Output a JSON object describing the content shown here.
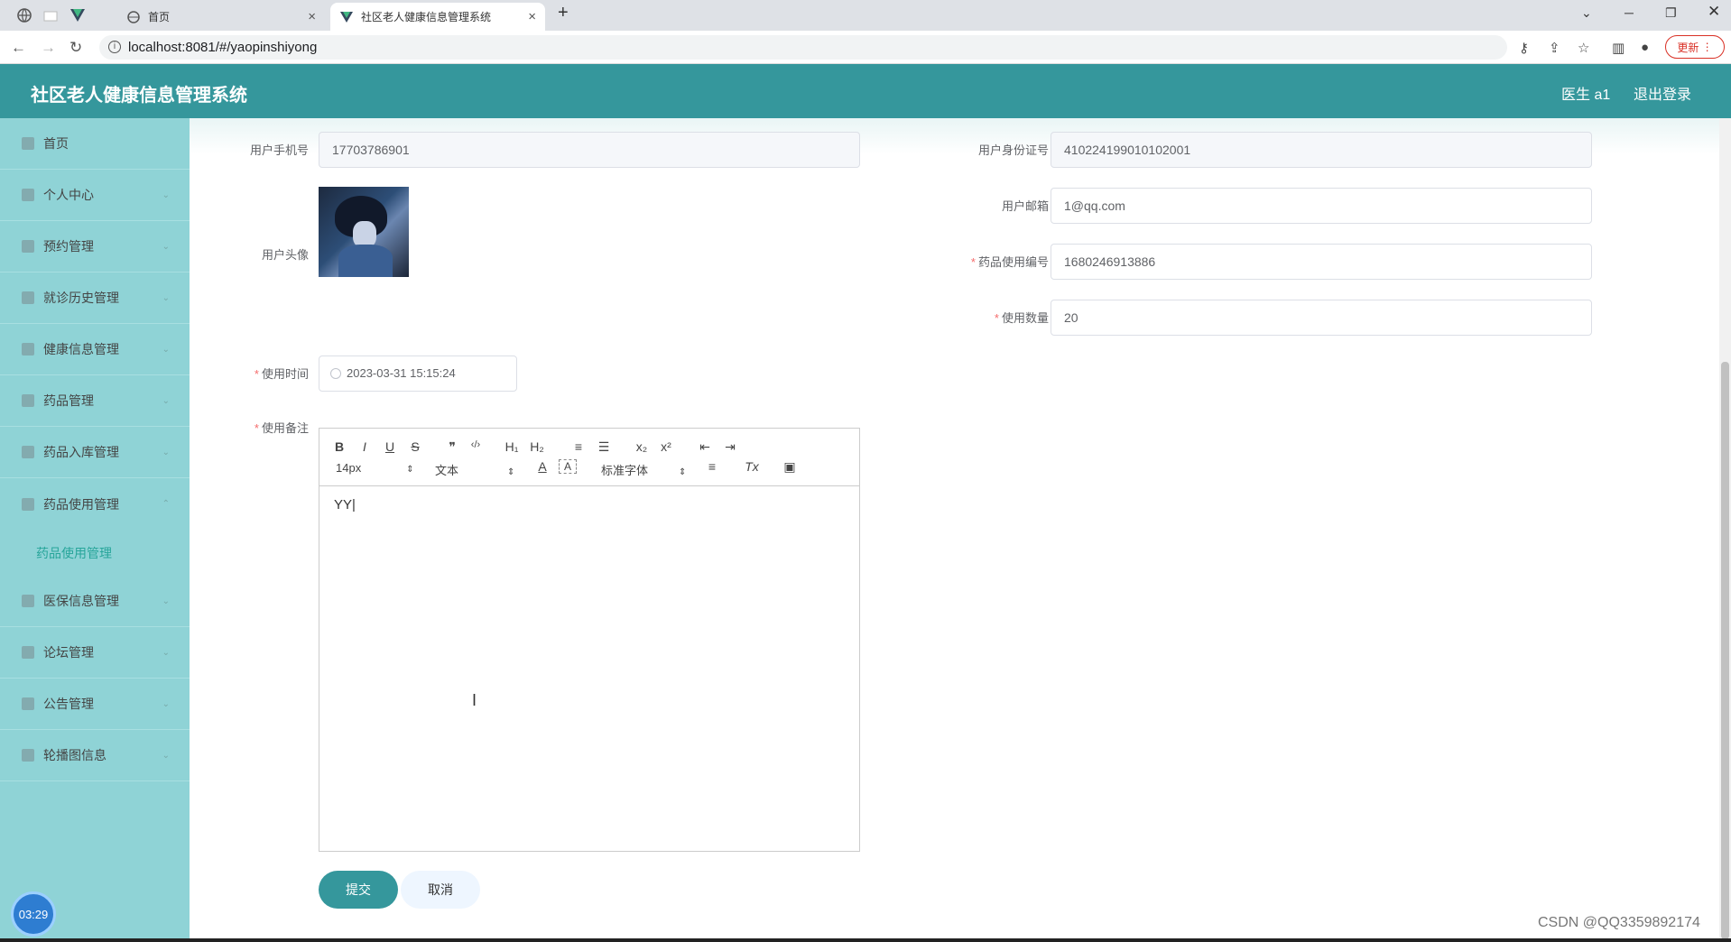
{
  "browser": {
    "tabs": [
      {
        "label": "首页"
      },
      {
        "label": "社区老人健康信息管理系统"
      }
    ],
    "url": "localhost:8081/#/yaopinshiyong",
    "update_label": "更新"
  },
  "header": {
    "title": "社区老人健康信息管理系统",
    "user": "医生 a1",
    "logout": "退出登录"
  },
  "sidebar": {
    "items": [
      {
        "label": "首页",
        "icon": "home-icon"
      },
      {
        "label": "个人中心",
        "icon": "user-icon"
      },
      {
        "label": "预约管理",
        "icon": "list-icon"
      },
      {
        "label": "就诊历史管理",
        "icon": "folder-icon"
      },
      {
        "label": "健康信息管理",
        "icon": "document-icon"
      },
      {
        "label": "药品管理",
        "icon": "box-icon"
      },
      {
        "label": "药品入库管理",
        "icon": "import-icon"
      },
      {
        "label": "药品使用管理",
        "icon": "circle-icon"
      },
      {
        "label": "医保信息管理",
        "icon": "card-icon"
      },
      {
        "label": "论坛管理",
        "icon": "grid-icon"
      },
      {
        "label": "公告管理",
        "icon": "sliders-icon"
      },
      {
        "label": "轮播图信息",
        "icon": "microphone-icon"
      }
    ],
    "sub_item": "药品使用管理",
    "timer": "03:29"
  },
  "form": {
    "phone": {
      "label": "用户手机号",
      "value": "17703786901"
    },
    "id_card": {
      "label": "用户身份证号",
      "value": "410224199010102001"
    },
    "avatar": {
      "label": "用户头像"
    },
    "email": {
      "label": "用户邮箱",
      "value": "1@qq.com"
    },
    "usage_no": {
      "label": "药品使用编号",
      "value": "1680246913886"
    },
    "quantity": {
      "label": "使用数量",
      "value": "20"
    },
    "time": {
      "label": "使用时间",
      "value": "2023-03-31 15:15:24"
    },
    "note": {
      "label": "使用备注",
      "value": "YY|"
    },
    "required_mark": "*"
  },
  "editor": {
    "font_size": "14px",
    "paragraph": "文本",
    "font_family": "标准字体",
    "buttons": {
      "bold": "B",
      "italic": "I",
      "underline": "U",
      "strike": "S",
      "quote": "❞",
      "code": "‹/›",
      "h1": "H₁",
      "h2": "H₂",
      "ordered": "≡",
      "bullet": "☰",
      "sub": "x₂",
      "sup": "x²",
      "outdent": "⇤",
      "indent": "⇥",
      "color": "A",
      "background": "A",
      "align": "≡",
      "clear": "Tx",
      "image": "▣"
    }
  },
  "actions": {
    "submit": "提交",
    "cancel": "取消"
  },
  "watermark": "CSDN @QQ3359892174"
}
